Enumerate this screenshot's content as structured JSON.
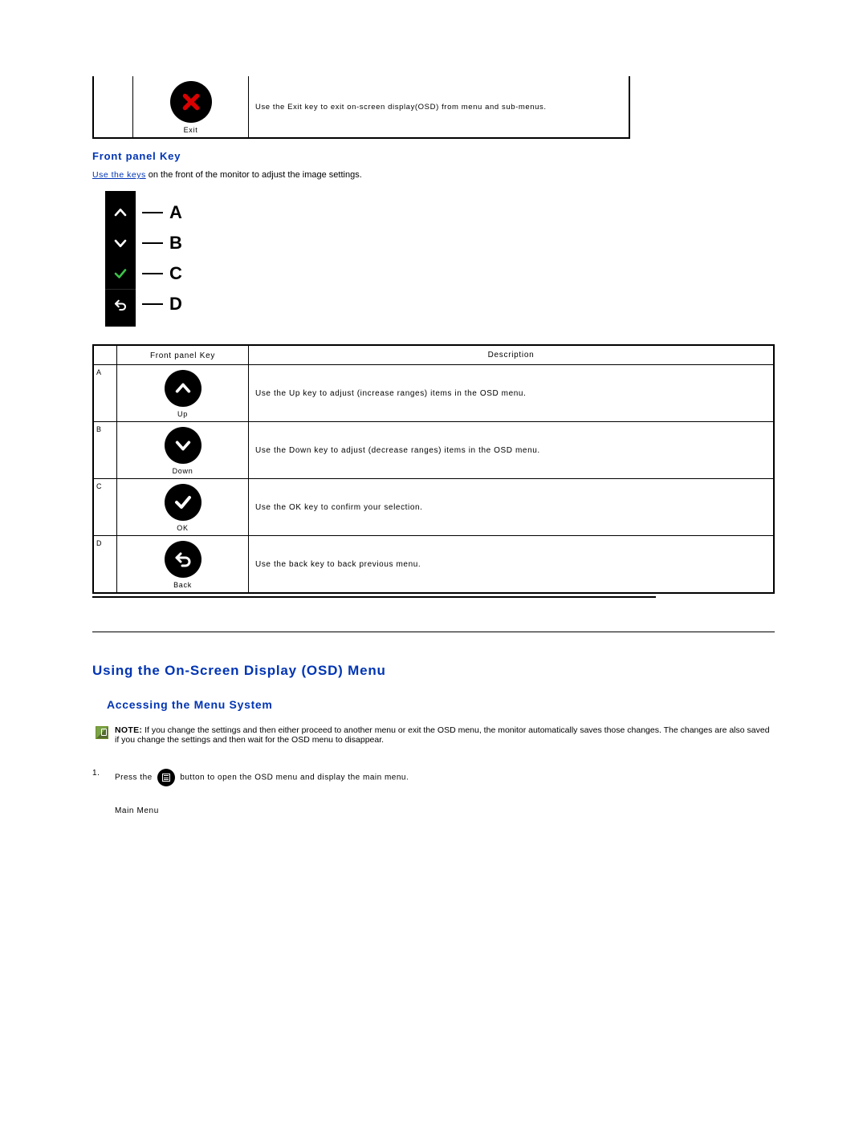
{
  "top_table": {
    "exit": {
      "label": "Exit",
      "desc": "Use the Exit key to exit on-screen display(OSD) from menu and sub-menus."
    }
  },
  "section1": {
    "heading": "Front panel Key",
    "link_text": "Use the keys",
    "intro_rest": " on the front of the monitor to adjust the image settings."
  },
  "diagram": {
    "labels": [
      "A",
      "B",
      "C",
      "D"
    ]
  },
  "table2": {
    "header_left": "Front panel Key",
    "header_right": "Description",
    "rows": [
      {
        "letter": "A",
        "label": "Up",
        "desc": "Use the Up key to adjust (increase ranges) items in the OSD menu."
      },
      {
        "letter": "B",
        "label": "Down",
        "desc": "Use the Down key to adjust (decrease ranges) items in the OSD menu."
      },
      {
        "letter": "C",
        "label": "OK",
        "desc": "Use the OK key to confirm your selection."
      },
      {
        "letter": "D",
        "label": "Back",
        "desc": "Use the back key to back previous menu."
      }
    ]
  },
  "section2": {
    "heading": "Using the On-Screen Display (OSD) Menu",
    "subheading": "Accessing the Menu System",
    "note_label": "NOTE:",
    "note_text": " If you change the settings and then either proceed to another menu or exit the OSD menu, the monitor automatically saves those changes. The changes are also saved if you change the settings and then wait for the OSD menu to disappear.",
    "step1_before": "Press the ",
    "step1_after": " button to open the OSD menu and display the main menu.",
    "main_menu_caption": "Main Menu"
  }
}
